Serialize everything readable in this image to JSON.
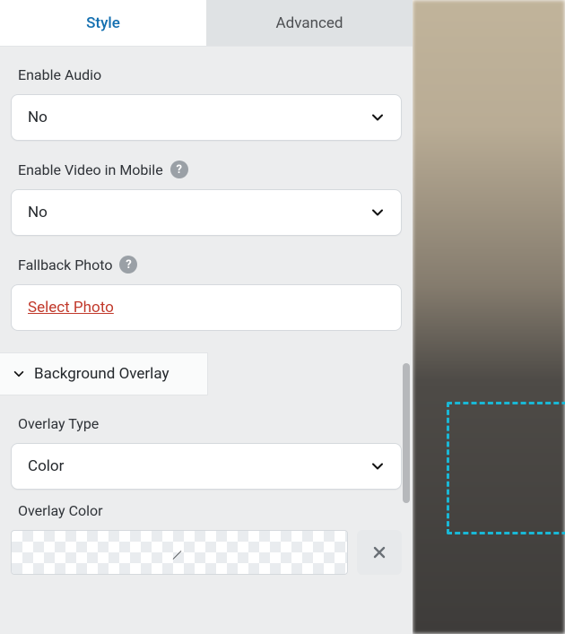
{
  "tabs": {
    "style": "Style",
    "advanced": "Advanced"
  },
  "enable_audio": {
    "label": "Enable Audio",
    "value": "No"
  },
  "enable_video_mobile": {
    "label": "Enable Video in Mobile",
    "value": "No"
  },
  "fallback_photo": {
    "label": "Fallback Photo",
    "action": "Select Photo"
  },
  "section_bg_overlay": {
    "title": "Background Overlay"
  },
  "overlay_type": {
    "label": "Overlay Type",
    "value": "Color"
  },
  "overlay_color": {
    "label": "Overlay Color"
  }
}
